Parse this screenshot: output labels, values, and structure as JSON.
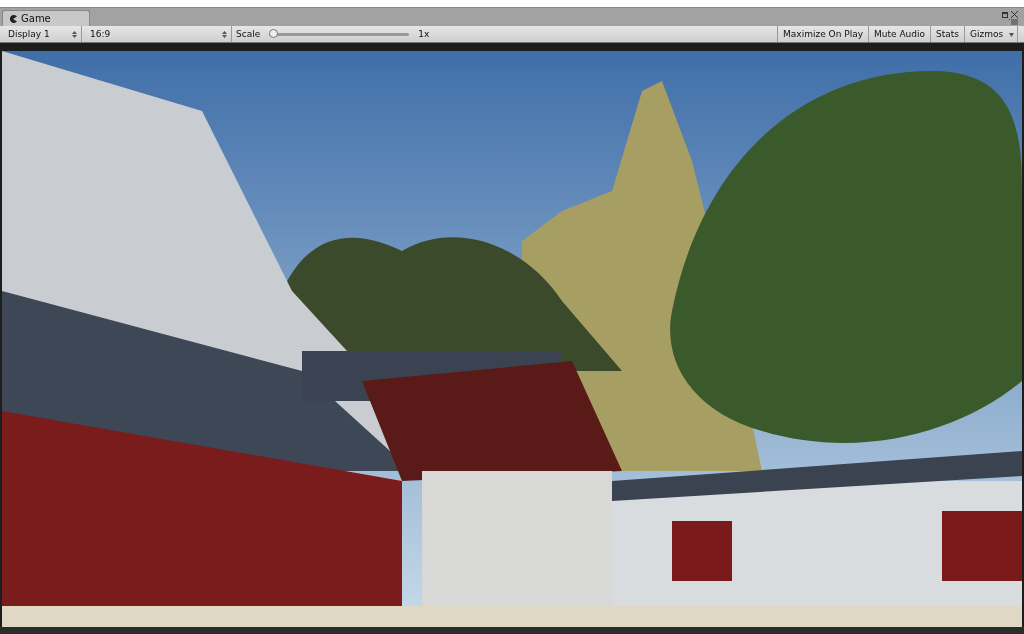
{
  "tab": {
    "label": "Game"
  },
  "toolbar": {
    "display": "Display 1",
    "aspect": "16:9",
    "scale": {
      "label": "Scale",
      "level": 0,
      "reading": "1x"
    },
    "buttons": [
      "Maximize On Play",
      "Mute Audio",
      "Stats"
    ],
    "gizmos": "Gizmos"
  }
}
